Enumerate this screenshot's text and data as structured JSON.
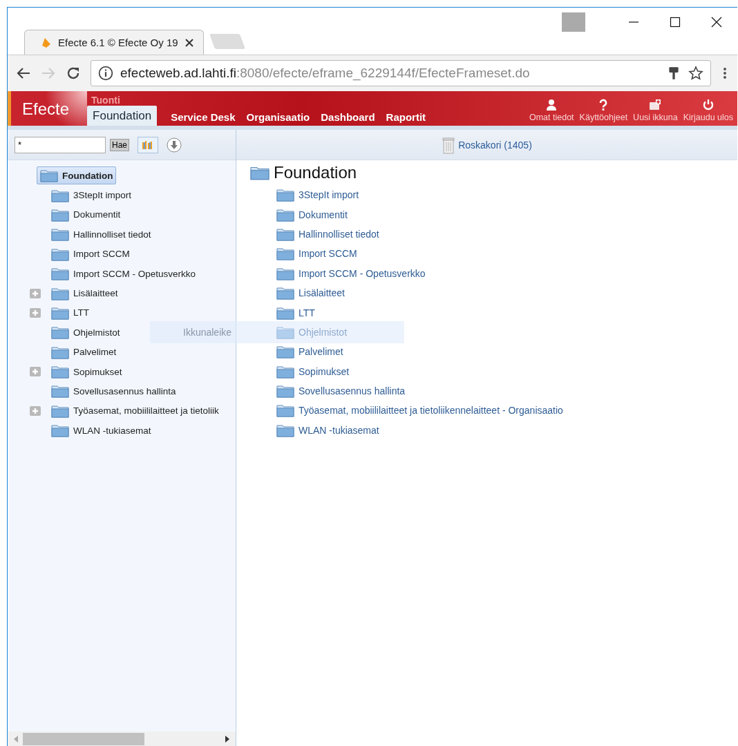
{
  "browser": {
    "tab_title": "Efecte 6.1 © Efecte Oy 19",
    "url_host": "efecteweb.ad.lahti.fi",
    "url_path": ":8080/efecte/eframe_6229144f/EfecteFrameset.do"
  },
  "header": {
    "logo": "Efecte",
    "context": "Tuonti",
    "nav": [
      {
        "label": "Foundation",
        "selected": true
      },
      {
        "label": "Service Desk",
        "selected": false
      },
      {
        "label": "Organisaatio",
        "selected": false
      },
      {
        "label": "Dashboard",
        "selected": false
      },
      {
        "label": "Raportit",
        "selected": false
      }
    ],
    "actions": [
      {
        "kind": "person",
        "label": "Omat tiedot"
      },
      {
        "kind": "help",
        "label": "Käyttöohjeet"
      },
      {
        "kind": "window",
        "label": "Uusi ikkuna"
      },
      {
        "kind": "power",
        "label": "Kirjaudu ulos"
      }
    ]
  },
  "search": {
    "value": "*",
    "button": "Hae"
  },
  "trash": {
    "label": "Roskakori (1405)"
  },
  "tree": [
    {
      "label": "Foundation",
      "selected": true,
      "expandable": false,
      "children": [
        {
          "label": "3StepIt import",
          "selected": false,
          "expandable": false
        },
        {
          "label": "Dokumentit",
          "selected": false,
          "expandable": false
        },
        {
          "label": "Hallinnolliset tiedot",
          "selected": false,
          "expandable": false
        },
        {
          "label": "Import SCCM",
          "selected": false,
          "expandable": false
        },
        {
          "label": "Import SCCM - Opetusverkko",
          "selected": false,
          "expandable": false
        },
        {
          "label": "Lisälaitteet",
          "selected": false,
          "expandable": true
        },
        {
          "label": "LTT",
          "selected": false,
          "expandable": true
        },
        {
          "label": "Ohjelmistot",
          "selected": false,
          "expandable": false
        },
        {
          "label": "Palvelimet",
          "selected": false,
          "expandable": false
        },
        {
          "label": "Sopimukset",
          "selected": false,
          "expandable": true
        },
        {
          "label": "Sovellusasennus hallinta",
          "selected": false,
          "expandable": false
        },
        {
          "label": "Työasemat, mobiililaitteet ja tietoliik",
          "selected": false,
          "expandable": true
        },
        {
          "label": "WLAN -tukiasemat",
          "selected": false,
          "expandable": false
        }
      ]
    }
  ],
  "folder": {
    "title": "Foundation",
    "items": [
      "3StepIt import",
      "Dokumentit",
      "Hallinnolliset tiedot",
      "Import SCCM",
      "Import SCCM - Opetusverkko",
      "Lisälaitteet",
      "LTT",
      "Ohjelmistot",
      "Palvelimet",
      "Sopimukset",
      "Sovellusasennus hallinta",
      "Työasemat, mobiililaitteet ja tietoliikennelaitteet - Organisaatio",
      "WLAN -tukiasemat"
    ]
  },
  "overlay_hint": "Ikkunaleike"
}
